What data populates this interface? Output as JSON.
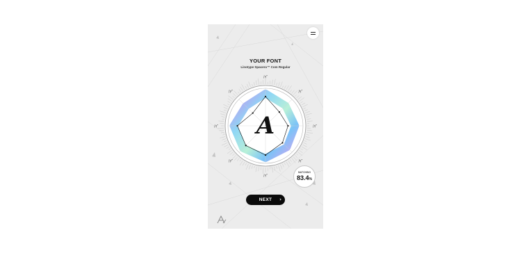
{
  "screen": {
    "title": "YOUR FONT",
    "font_name": "Linotype Spacera™ Com Regular",
    "menu_icon": "hamburger-menu-icon"
  },
  "radar": {
    "center_glyph": "A",
    "axis_labels": [
      "∫γ“",
      "∫γ“",
      "∫γ“",
      "∫γ“",
      "∫γ“",
      "∫γ“",
      "∫γ“",
      "∫γ“"
    ],
    "values": [
      0.78,
      0.52,
      0.6,
      0.64,
      0.78,
      0.74,
      0.75,
      0.48
    ]
  },
  "match": {
    "label": "MATCHING",
    "value": "83.4",
    "unit": "%"
  },
  "next_button": {
    "label": "NEXT",
    "arrow_icon": "chevron-right-icon"
  },
  "logo_icon": "brand-logo-icon"
}
